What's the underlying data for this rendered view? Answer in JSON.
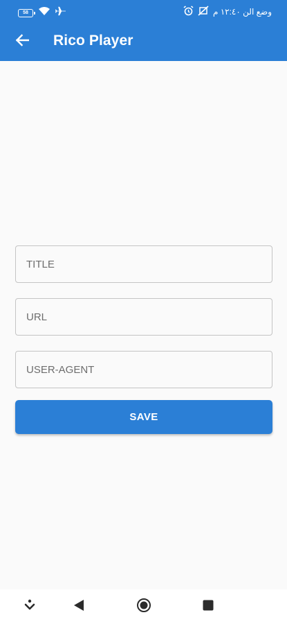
{
  "colors": {
    "primary": "#2b7fd6",
    "background": "#fafafa",
    "field_border": "#c4c4c4"
  },
  "status_bar": {
    "battery_level": "58",
    "status_text": "وضع الن ١٢:٤٠ م",
    "left_icons": [
      "battery-icon",
      "wifi-icon",
      "airplane-mode-icon"
    ],
    "right_icons": [
      "alarm-icon",
      "no-data-icon"
    ]
  },
  "toolbar": {
    "title": "Rico Player",
    "back_icon": "arrow-left-icon"
  },
  "form": {
    "title_placeholder": "TITLE",
    "title_value": "",
    "url_placeholder": "URL",
    "url_value": "",
    "user_agent_placeholder": "USER-AGENT",
    "user_agent_value": "",
    "save_label": "SAVE"
  },
  "nav_bar": {
    "icons": [
      "download-icon",
      "back-triangle-icon",
      "home-circle-icon",
      "recents-square-icon"
    ]
  }
}
